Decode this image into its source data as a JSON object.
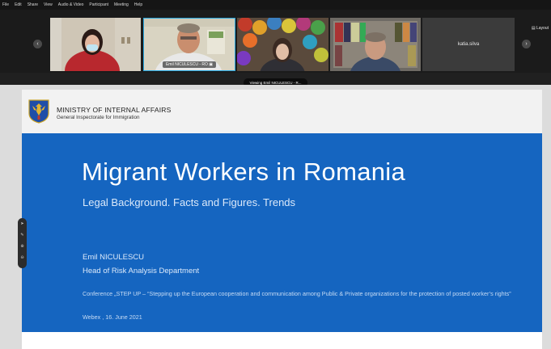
{
  "menu": [
    "File",
    "Edit",
    "Share",
    "View",
    "Audio & Video",
    "Participant",
    "Meeting",
    "Help"
  ],
  "participants": {
    "prev_icon": "chevron-left-icon",
    "next_icon": "chevron-right-icon",
    "speaker_name": "Emil NICULESCU - RO",
    "speaker_share_icon": "screen-share-icon",
    "tile_name": "katia.silva"
  },
  "layout_label": "Layout",
  "viewing_badge": "Viewing Emil NICULESCU - R...",
  "slide": {
    "ministry": "MINISTRY OF INTERNAL AFFAIRS",
    "inspectorate": "General Inspectorate for Immigration",
    "title": "Migrant Workers in Romania",
    "subtitle": "Legal Background. Facts and Figures. Trends",
    "presenter": "Emil NICULESCU",
    "role": "Head of Risk Analysis Department",
    "conference": "Conference „STEP UP – “Stepping up the European cooperation and communication among Public & Private organizations for the protection of posted worker’s rights”",
    "venue": "Webex , 16. June 2021"
  },
  "colors": {
    "slide_blue": "#1565c0",
    "active_border": "#29a8e0"
  }
}
